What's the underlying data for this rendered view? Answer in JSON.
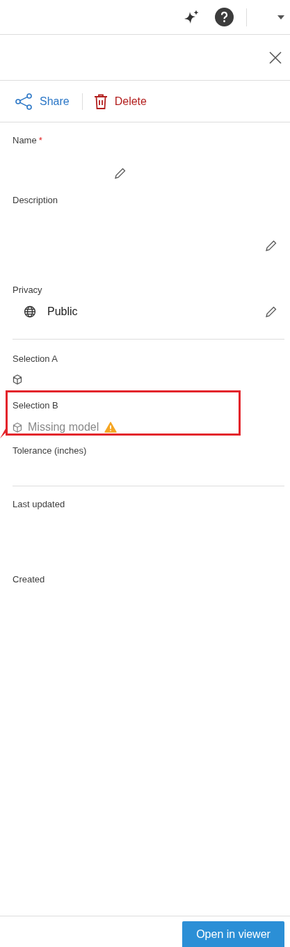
{
  "actions": [
    {
      "kind": "share",
      "label": "Share"
    },
    {
      "kind": "delete",
      "label": "Delete"
    }
  ],
  "sections": [
    {
      "fields": [
        {
          "kind": "short-text",
          "label": "Name",
          "required_mark": "*"
        },
        {
          "kind": "long-text",
          "label": "Description"
        },
        {
          "kind": "privacy",
          "label": "Privacy",
          "value": "Public"
        }
      ]
    },
    {
      "fields": [
        {
          "kind": "selection",
          "label": "Selection A",
          "highlighted": false
        },
        {
          "kind": "selection",
          "label": "Selection B",
          "value": "Missing model",
          "warning": true,
          "highlighted": true
        },
        {
          "kind": "number",
          "label": "Tolerance (inches)"
        }
      ]
    },
    {
      "fields": [
        {
          "kind": "date",
          "label": "Last updated"
        },
        {
          "kind": "date",
          "label": "Created"
        }
      ]
    }
  ],
  "footer": {
    "button": "Open in viewer"
  }
}
